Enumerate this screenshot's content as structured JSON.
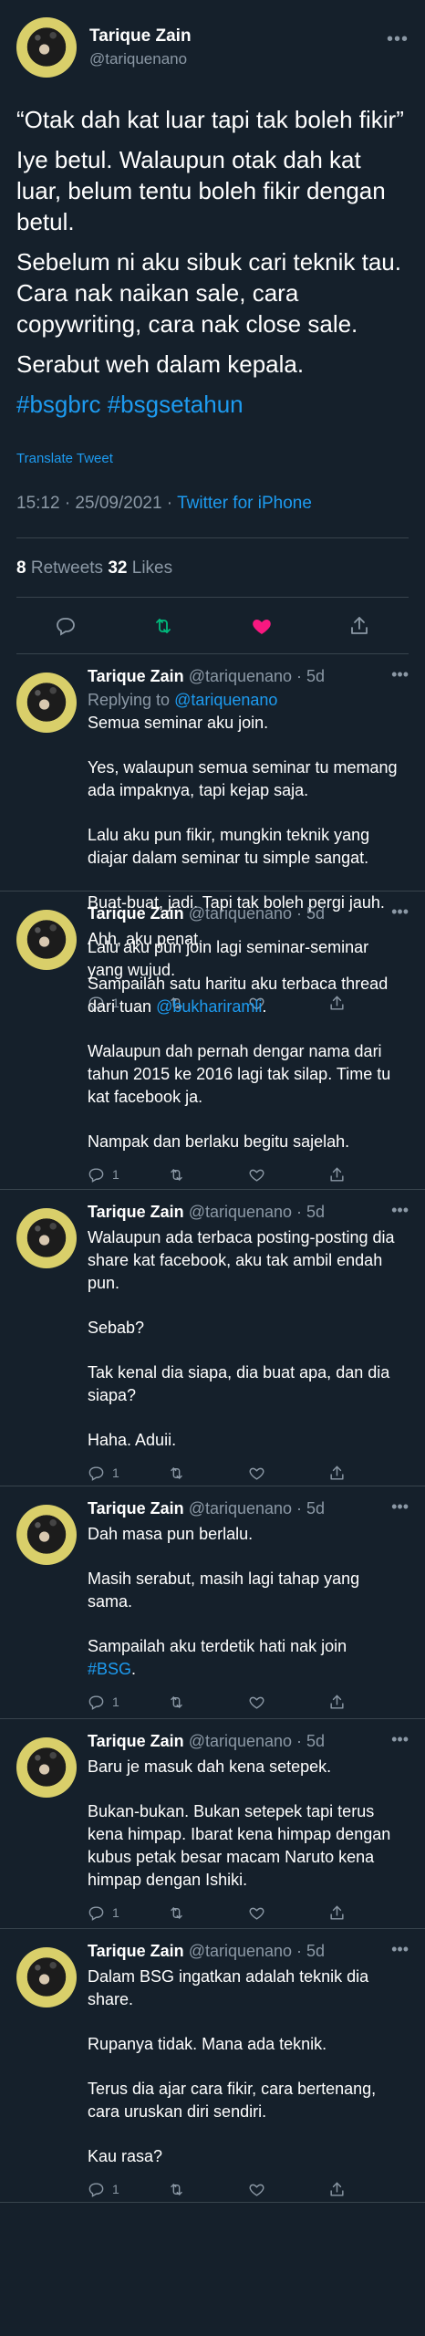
{
  "main": {
    "name": "Tarique Zain",
    "handle": "@tariquenano",
    "paragraphs": [
      "“Otak dah kat luar tapi tak boleh fikir”",
      "Iye betul. Walaupun otak dah kat luar, belum tentu boleh fikir dengan betul.",
      "Sebelum ni aku sibuk cari teknik tau. Cara nak naikan sale, cara copywriting, cara nak close sale.",
      "Serabut weh dalam kepala."
    ],
    "hashtags": "#bsgbrc #bsgsetahun",
    "translate": "Translate Tweet",
    "timestamp": "15:12 · 25/09/2021 · ",
    "source": "Twitter for iPhone",
    "retweets_count": "8",
    "retweets_label": " Retweets  ",
    "likes_count": "32",
    "likes_label": " Likes"
  },
  "replies": [
    {
      "name": "Tarique Zain",
      "meta": " @tariquenano · 5d",
      "replying_prefix": "Replying to ",
      "replying_to": "@tariquenano",
      "paragraphs": [
        "Semua seminar aku join.",
        "Yes, walaupun semua seminar tu memang ada impaknya, tapi kejap saja.",
        "Lalu aku pun fikir, mungkin teknik yang diajar dalam seminar tu simple sangat.",
        "Buat-buat, jadi. Tapi tak boleh pergi jauh.",
        "Lalu aku pun join lagi seminar-seminar yang wujud."
      ],
      "reply_count": "1"
    },
    {
      "name": "Tarique Zain",
      "meta": " @tariquenano · 5d",
      "p1": "Ahh, aku penat.",
      "p2_text": "Sampailah satu haritu aku terbaca thread dari tuan ",
      "p2_link": "@bukhariramli",
      "p2_end": ".",
      "p3": "Walaupun dah pernah dengar nama dari tahun 2015 ke 2016 lagi tak silap. Time tu kat facebook ja.",
      "p4": "Nampak dan berlaku begitu sajelah.",
      "reply_count": "1"
    },
    {
      "name": "Tarique Zain",
      "meta": " @tariquenano · 5d",
      "paragraphs": [
        "Walaupun ada terbaca posting-posting dia share kat facebook, aku tak ambil endah pun.",
        "Sebab?",
        "Tak kenal dia siapa, dia buat apa, dan dia siapa?",
        "Haha. Aduii."
      ],
      "reply_count": "1"
    },
    {
      "name": "Tarique Zain",
      "meta": " @tariquenano · 5d",
      "p1": "Dah masa pun berlalu.",
      "p2": "Masih serabut, masih lagi tahap yang sama.",
      "p3": "Sampailah aku terdetik hati nak join",
      "p3_link": "#BSG",
      "p3_end": ".",
      "reply_count": "1"
    },
    {
      "name": "Tarique Zain",
      "meta": " @tariquenano · 5d",
      "paragraphs": [
        "Baru je masuk dah kena setepek.",
        "Bukan-bukan. Bukan setepek tapi terus kena himpap. Ibarat kena himpap dengan kubus petak besar macam Naruto kena himpap dengan Ishiki."
      ],
      "reply_count": "1"
    },
    {
      "name": "Tarique Zain",
      "meta": " @tariquenano · 5d",
      "paragraphs": [
        "Dalam BSG ingatkan adalah teknik dia share.",
        "Rupanya tidak. Mana ada teknik.",
        "Terus dia ajar cara fikir, cara bertenang, cara uruskan diri sendiri.",
        "Kau rasa?"
      ],
      "reply_count": "1"
    }
  ],
  "icons": {
    "reply": "comment-icon",
    "retweet": "retweet-icon",
    "like": "heart-icon",
    "share": "share-icon",
    "more": "more-icon"
  },
  "colors": {
    "background": "#15202b",
    "accent": "#1d9bf0",
    "retweet": "#00ba7c",
    "like": "#f91880",
    "muted": "#8b98a5"
  }
}
